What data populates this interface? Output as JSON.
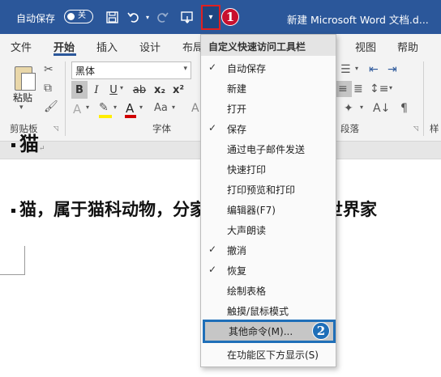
{
  "titlebar": {
    "autosave_label": "自动保存",
    "autosave_state": "关",
    "doc_title": "新建 Microsoft Word 文档.d...",
    "qat_dropdown_icon": "▾",
    "annotations": [
      "1",
      "2"
    ]
  },
  "tabs": [
    {
      "label": "文件"
    },
    {
      "label": "开始"
    },
    {
      "label": "插入"
    },
    {
      "label": "设计"
    },
    {
      "label": "布局"
    },
    {
      "label": "视图"
    },
    {
      "label": "帮助"
    }
  ],
  "ribbon": {
    "paste_label": "粘贴",
    "clipboard_label": "剪贴板",
    "font_label": "字体",
    "paragraph_label": "段落",
    "styles_label_partial": "样",
    "font_name": "黑体",
    "format_buttons": [
      "B",
      "I",
      "U",
      "ab",
      "x₂",
      "x²"
    ]
  },
  "qat_menu": {
    "header": "自定义快速访问工具栏",
    "items": [
      {
        "label": "自动保存",
        "checked": true
      },
      {
        "label": "新建",
        "checked": false
      },
      {
        "label": "打开",
        "checked": false
      },
      {
        "label": "保存",
        "checked": true
      },
      {
        "label": "通过电子邮件发送",
        "checked": false
      },
      {
        "label": "快速打印",
        "checked": false
      },
      {
        "label": "打印预览和打印",
        "checked": false
      },
      {
        "label": "编辑器(F7)",
        "checked": false
      },
      {
        "label": "大声朗读",
        "checked": false
      },
      {
        "label": "撤消",
        "checked": true
      },
      {
        "label": "恢复",
        "checked": true
      },
      {
        "label": "绘制表格",
        "checked": false
      },
      {
        "label": "触摸/鼠标模式",
        "checked": false
      },
      {
        "label": "其他命令(M)...",
        "checked": false,
        "highlighted": true
      },
      {
        "label": "在功能区下方显示(S)",
        "checked": false
      }
    ]
  },
  "document": {
    "heading": "猫",
    "paragraph": "猫，属于猫科动物，分家猫、野猫，是全世界家"
  },
  "colors": {
    "titlebar": "#2b579a",
    "highlight_border": "#1f6fb8",
    "annotation_red": "#c8102e"
  }
}
